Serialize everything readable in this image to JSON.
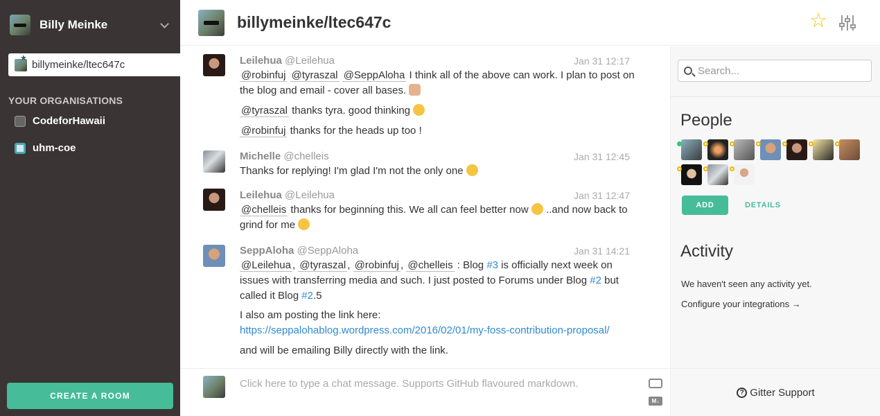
{
  "user": {
    "name": "Billy Meinke"
  },
  "sidebar": {
    "current_room": "billymeinke/ltec647c",
    "org_heading": "YOUR ORGANISATIONS",
    "orgs": [
      "CodeforHawaii",
      "uhm-coe"
    ],
    "create_room_label": "CREATE A ROOM"
  },
  "header": {
    "title": "billymeinke/ltec647c"
  },
  "messages": [
    {
      "author": "Leilehua",
      "handle": "@Leilehua",
      "time": "Jan 31 12:17",
      "lines": [
        {
          "mentions": [
            "@robinfuj",
            "@tyraszal",
            "@SeppAloha"
          ],
          "text": " I think all of the above can work. I plan to post on the blog and email - cover all bases. "
        },
        {
          "mention": "@tyraszal",
          "text": " thanks tyra. good thinking "
        },
        {
          "mention": "@robinfuj",
          "text": " thanks for the heads up too !"
        }
      ]
    },
    {
      "author": "Michelle",
      "handle": "@chelleis",
      "time": "Jan 31 12:45",
      "lines": [
        {
          "text": "Thanks for replying! I'm glad I'm not the only one "
        }
      ]
    },
    {
      "author": "Leilehua",
      "handle": "@Leilehua",
      "time": "Jan 31 12:47",
      "lines": [
        {
          "mention": "@chelleis",
          "text1": " thanks for beginning this. We all can feel better now ",
          "text2": " ..and now back to grind for me "
        }
      ]
    },
    {
      "author": "SeppAloha",
      "handle": "@SeppAloha",
      "time": "Jan 31 14:21",
      "lines": [
        {
          "mentions": [
            "@Leilehua",
            "@tyraszal",
            "@robinfuj",
            "@chelleis"
          ],
          "sep": ",",
          "t1": " : Blog ",
          "issue1": "#3",
          "t2": " is officially next week on issues with transferring media and such. I just posted to Forums under Blog ",
          "issue2": "#2",
          "t3": " but called it Blog ",
          "issue3": "#2",
          "t4": ".5"
        },
        {
          "text": "I also am posting the link here:",
          "link": "https://seppalohablog.wordpress.com/2016/02/01/my-foss-contribution-proposal/"
        },
        {
          "text": "and will be emailing Billy directly with the link."
        }
      ]
    }
  ],
  "composer": {
    "placeholder": "Click here to type a chat message. Supports GitHub flavoured markdown.",
    "markdown_badge": "M↓"
  },
  "right_panel": {
    "search_placeholder": "Search...",
    "people_title": "People",
    "add_label": "ADD",
    "details_label": "DETAILS",
    "activity_title": "Activity",
    "activity_empty": "We haven't seen any activity yet.",
    "configure_link": "Configure your integrations →",
    "support_label": "Gitter Support",
    "support_icon_glyph": "?"
  },
  "colors": {
    "accent": "#46bc99",
    "sidebar_bg": "#3a3434",
    "star": "#f1c40f",
    "link": "#3089d3"
  }
}
